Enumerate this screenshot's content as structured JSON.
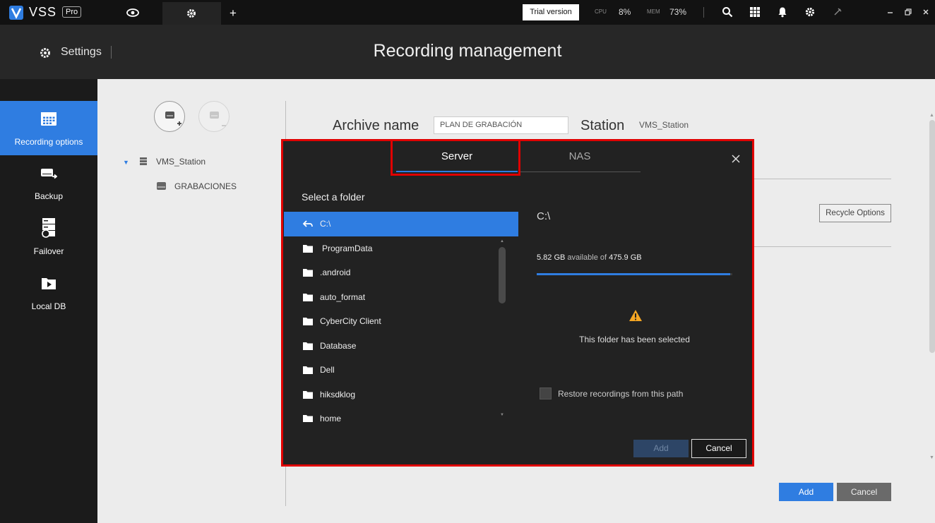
{
  "topbar": {
    "logo_text": "VSS",
    "logo_badge": "Pro",
    "tabs": [
      {
        "name": "live-view",
        "icon": "eye-icon"
      },
      {
        "name": "settings",
        "icon": "gear-icon"
      }
    ],
    "new_tab_label": "+",
    "trial_label": "Trial version",
    "cpu_label": "CPU",
    "cpu_value": "8%",
    "mem_label": "MEM",
    "mem_value": "73%",
    "icons": [
      "search-icon",
      "grid-icon",
      "bell-icon",
      "gear-icon",
      "pin-icon"
    ],
    "window_controls": [
      "minimize-icon",
      "restore-icon",
      "close-icon"
    ]
  },
  "header": {
    "settings_label": "Settings",
    "title": "Recording management"
  },
  "sidebar": {
    "items": [
      {
        "label": "Recording options",
        "icon": "calendar-icon",
        "active": true
      },
      {
        "label": "Backup",
        "icon": "backup-icon",
        "active": false
      },
      {
        "label": "Failover",
        "icon": "failover-icon",
        "active": false
      },
      {
        "label": "Local DB",
        "icon": "local-db-icon",
        "active": false
      }
    ]
  },
  "tree": {
    "station": "VMS_Station",
    "child": "GRABACIONES"
  },
  "form": {
    "archive_label": "Archive name",
    "archive_value": "PLAN DE GRABACIÓN",
    "station_label": "Station",
    "station_value": "VMS_Station",
    "recycle_button": "Recycle Options",
    "add_button": "Add",
    "cancel_button": "Cancel"
  },
  "dialog": {
    "tabs": [
      {
        "label": "Server",
        "active": true
      },
      {
        "label": "NAS",
        "active": false
      }
    ],
    "select_label": "Select a folder",
    "folders": [
      {
        "label": "C:\\",
        "type": "back",
        "selected": true
      },
      {
        "label": "ProgramData",
        "type": "folder"
      },
      {
        "label": ".android",
        "type": "folder"
      },
      {
        "label": "auto_format",
        "type": "folder"
      },
      {
        "label": "CyberCity Client",
        "type": "folder"
      },
      {
        "label": "Database",
        "type": "folder"
      },
      {
        "label": "Dell",
        "type": "folder"
      },
      {
        "label": "hiksdklog",
        "type": "folder"
      },
      {
        "label": "home",
        "type": "folder"
      }
    ],
    "path": "C:\\",
    "available": "5.82 GB",
    "available_of": "available of",
    "total": "475.9 GB",
    "used_fraction": 0.988,
    "warning_text": "This folder has been selected",
    "restore_label": "Restore recordings from this path",
    "add_button": "Add",
    "cancel_button": "Cancel"
  },
  "colors": {
    "accent": "#2f7de1",
    "highlight": "#e00000",
    "warning": "#f5a623"
  }
}
